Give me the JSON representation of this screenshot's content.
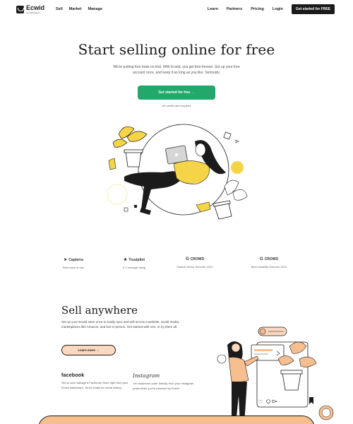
{
  "header": {
    "logo_name": "Ecwid",
    "logo_sub": "by Lightspeed",
    "nav_left": [
      "Sell",
      "Market",
      "Manage"
    ],
    "nav_right": [
      "Learn",
      "Partners",
      "Pricing",
      "Login"
    ],
    "cta": "Get started for FREE"
  },
  "hero": {
    "title": "Start selling online for free",
    "subtitle": "We're putting free trials on trial. With Ecwid, you get free forever. Set up your free account once, and keep it as long as you like. Seriously.",
    "cta": "Get started for free →",
    "note": "No credit card required"
  },
  "ratings": [
    {
      "brand": "Capterra",
      "icon": "capterra-arrow-icon",
      "text": "Best ease of use"
    },
    {
      "brand": "Trustpilot",
      "icon": "star-icon",
      "text": "4.7 average rating"
    },
    {
      "brand": "CROWD",
      "icon": "g2-icon",
      "text": "Easiest Setup Summer 2021"
    },
    {
      "brand": "CROWD",
      "icon": "g2-icon",
      "text": "Best Usability Summer 2021"
    }
  ],
  "sell": {
    "title": "Sell anywhere",
    "description": "Set up your Ecwid store once to easily sync and sell across a website, social media, marketplaces like Amazon, and live in-person. Get started with one, or try them all.",
    "cta": "Learn more →",
    "channels": [
      {
        "name": "facebook",
        "description": "Set up and manage a Facebook Store right from your Ecwid dashboard. You're ready for social selling."
      },
      {
        "name": "Instagram",
        "description": "Let customers order directly from your Instagram posts when you're powered by Ecwid."
      }
    ]
  },
  "colors": {
    "accent_green": "#22a86b",
    "peach": "#f7be8f",
    "yellow": "#f5d547",
    "dark": "#1b1b1b"
  }
}
